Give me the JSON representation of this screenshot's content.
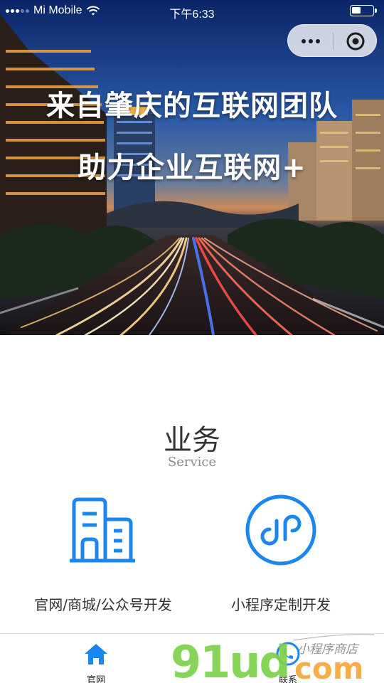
{
  "status_bar": {
    "carrier": "Mi Mobile",
    "time": "下午6:33"
  },
  "hero": {
    "headline_line1": "来自肇庆的互联网团队",
    "headline_line2": "助力企业互联网+"
  },
  "services_section": {
    "title": "业务",
    "subtitle": "Service",
    "items": [
      {
        "label": "官网/商城/公众号开发",
        "icon": "building-icon"
      },
      {
        "label": "小程序定制开发",
        "icon": "mini-program-icon"
      }
    ]
  },
  "tab_bar": {
    "items": [
      {
        "label": "官网",
        "icon": "home-icon",
        "active": true
      },
      {
        "label": "联系",
        "icon": "phone-icon",
        "active": false
      }
    ]
  },
  "watermark": {
    "logo_text": "91ud.com",
    "tagline": "小程序商店"
  },
  "colors": {
    "accent": "#1b86f0",
    "text": "#333333",
    "subtitle": "#8a8a8a",
    "watermark_green": "#7cd14a",
    "watermark_orange": "#f7a83a"
  }
}
